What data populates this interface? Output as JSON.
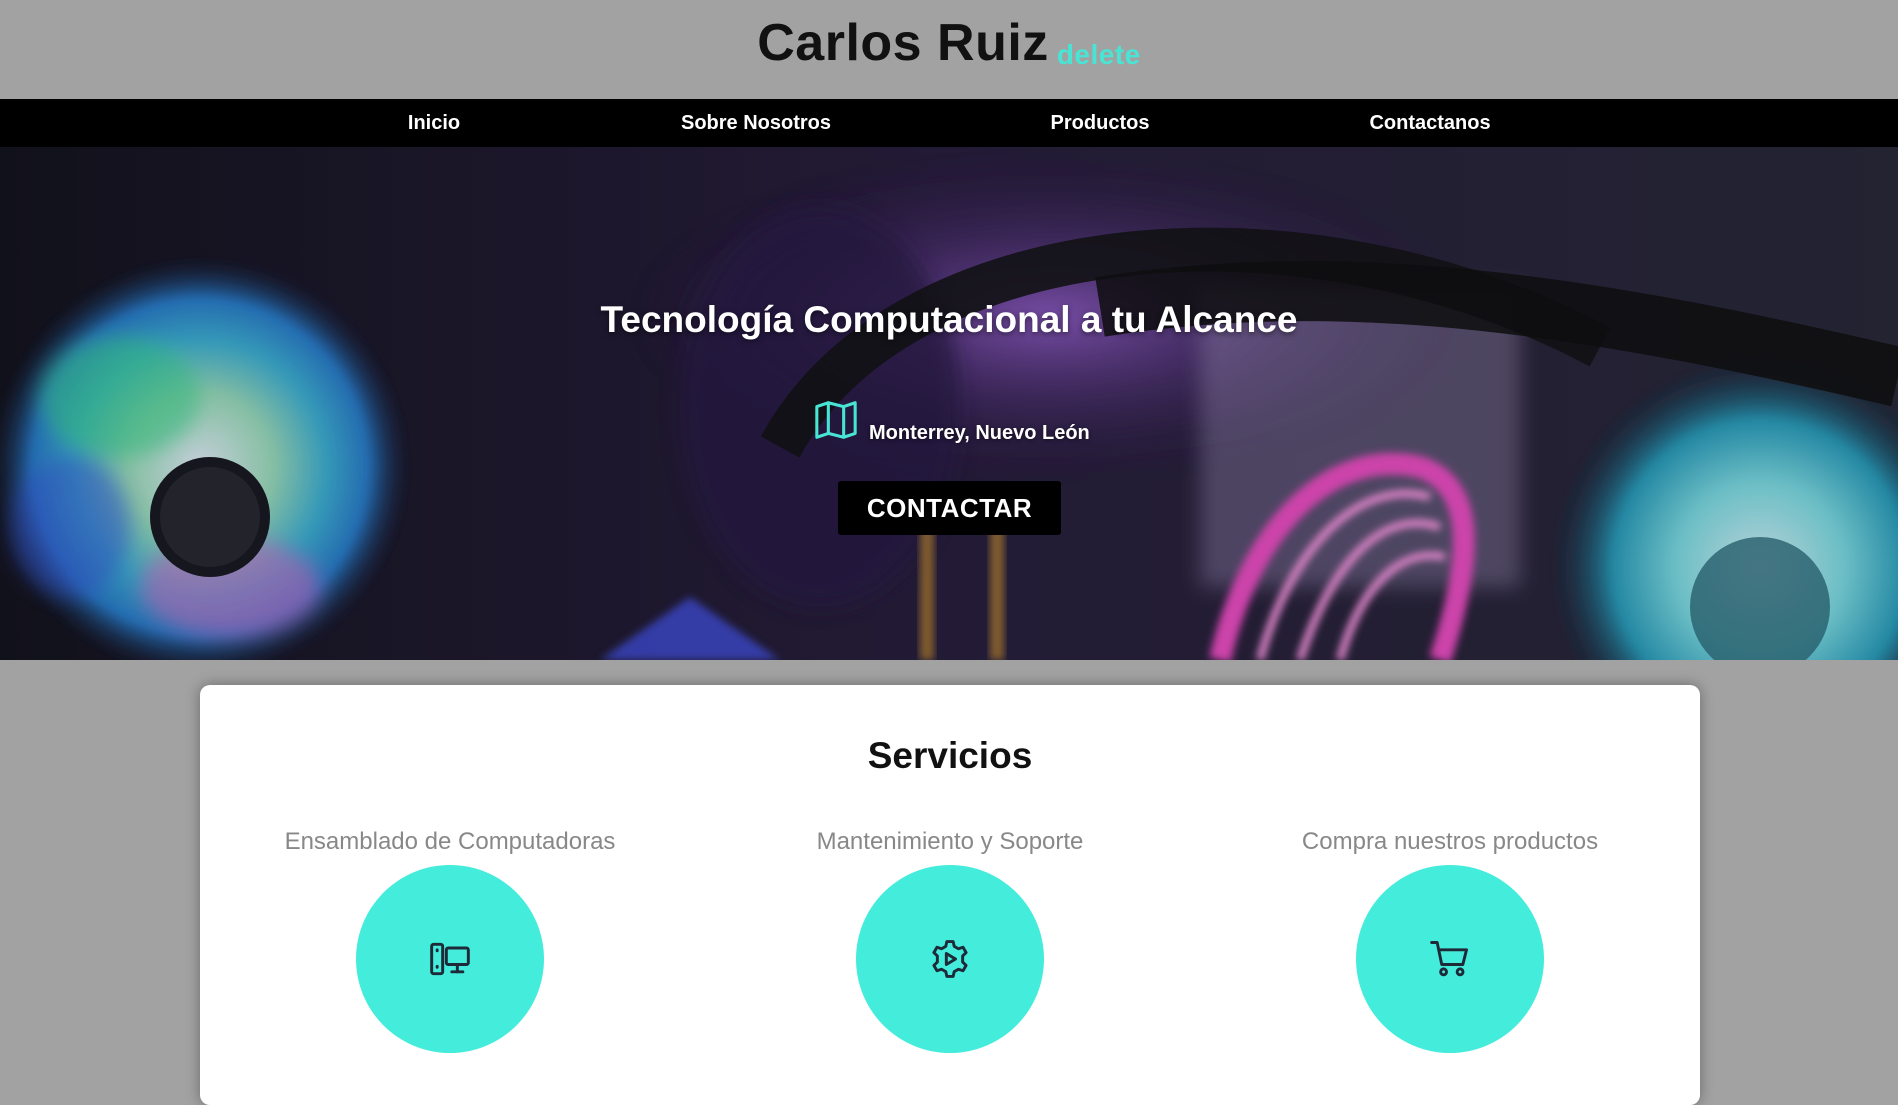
{
  "header": {
    "title": "Carlos Ruiz",
    "accent": "delete"
  },
  "nav": {
    "items": [
      {
        "label": "Inicio"
      },
      {
        "label": "Sobre Nosotros"
      },
      {
        "label": "Productos"
      },
      {
        "label": "Contactanos"
      }
    ]
  },
  "hero": {
    "title": "Tecnología Computacional a tu Alcance",
    "location": "Monterrey, Nuevo León",
    "location_icon": "map-icon",
    "cta_label": "CONTACTAR"
  },
  "services": {
    "title": "Servicios",
    "items": [
      {
        "label": "Ensamblado de Computadoras",
        "icon": "devices-icon"
      },
      {
        "label": "Mantenimiento y Soporte",
        "icon": "settings-play-icon"
      },
      {
        "label": "Compra nuestros productos",
        "icon": "shopping-cart-icon"
      }
    ]
  },
  "colors": {
    "accent": "#48e5d4",
    "circle": "#44ecdc",
    "page_background": "#a2a2a2",
    "nav_background": "#000000"
  }
}
